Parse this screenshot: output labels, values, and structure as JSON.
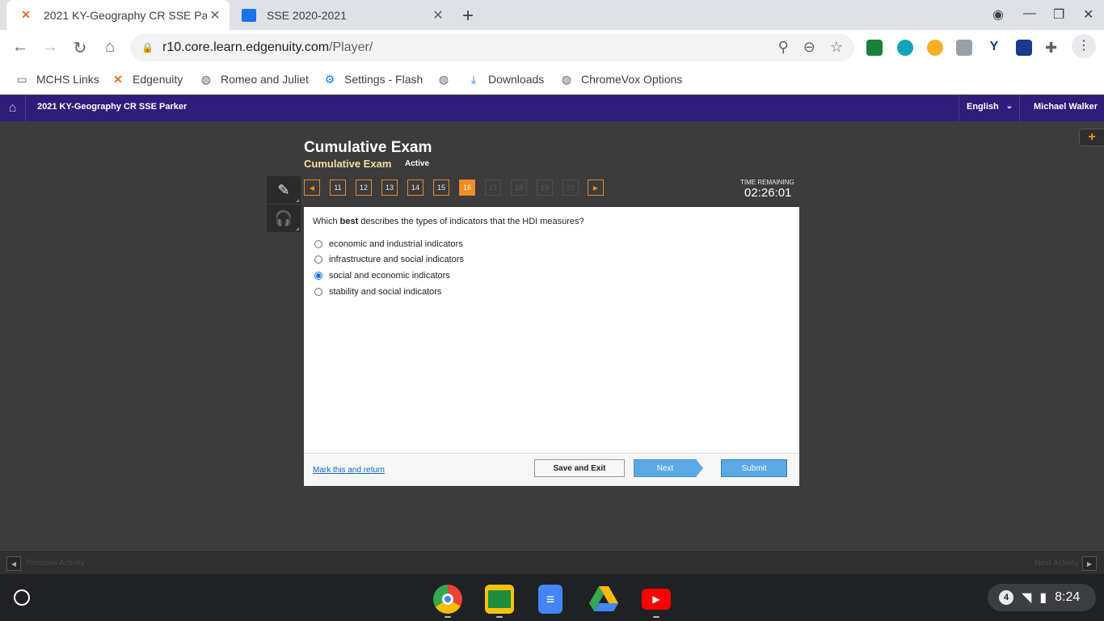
{
  "browser": {
    "tabs": [
      {
        "title": "2021 KY-Geography CR SSE Parker",
        "active": true
      },
      {
        "title": "SSE 2020-2021",
        "active": false
      }
    ],
    "url_host": "r10.core.learn.edgenuity.com",
    "url_path": "/Player/",
    "bookmarks": [
      "MCHS Links",
      "Edgenuity",
      "Romeo and Juliet",
      "Settings - Flash",
      "",
      "Downloads",
      "ChromeVox Options"
    ]
  },
  "header": {
    "course_title": "2021 KY-Geography CR SSE Parker",
    "language": "English",
    "user": "Michael Walker"
  },
  "exam": {
    "title": "Cumulative Exam",
    "subtitle": "Cumulative Exam",
    "status": "Active",
    "questions": [
      {
        "num": "11",
        "state": "answered"
      },
      {
        "num": "12",
        "state": "answered"
      },
      {
        "num": "13",
        "state": "answered"
      },
      {
        "num": "14",
        "state": "answered"
      },
      {
        "num": "15",
        "state": "answered"
      },
      {
        "num": "16",
        "state": "current"
      },
      {
        "num": "17",
        "state": "disabled"
      },
      {
        "num": "18",
        "state": "disabled"
      },
      {
        "num": "19",
        "state": "disabled"
      },
      {
        "num": "20",
        "state": "disabled"
      }
    ],
    "timer_label": "TIME REMAINING",
    "timer_value": "02:26:01"
  },
  "question": {
    "prompt_before": "Which ",
    "prompt_bold": "best",
    "prompt_after": " describes the types of indicators that the HDI measures?",
    "answers": [
      {
        "text": "economic and industrial indicators",
        "selected": false
      },
      {
        "text": "infrastructure and social indicators",
        "selected": false
      },
      {
        "text": "social and economic indicators",
        "selected": true
      },
      {
        "text": "stability and social indicators",
        "selected": false
      }
    ]
  },
  "footer": {
    "mark_label": "Mark this and return",
    "save_label": "Save and Exit",
    "next_label": "Next",
    "submit_label": "Submit"
  },
  "activity": {
    "prev_label": "Previous Activity",
    "next_label": "Next Activity"
  },
  "system": {
    "notification_count": "4",
    "time": "8:24"
  },
  "colors": {
    "header_bg": "#301c7a",
    "accent_orange": "#f28c22",
    "button_blue": "#5aa9e6"
  }
}
